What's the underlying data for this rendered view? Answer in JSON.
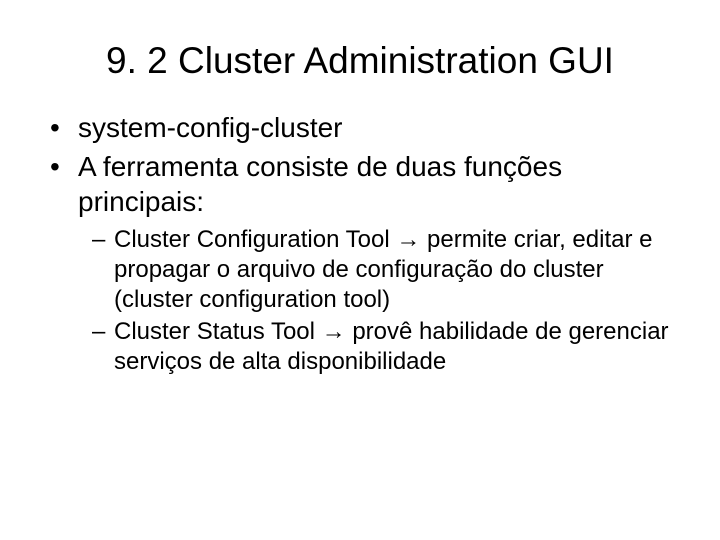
{
  "title": "9. 2 Cluster Administration GUI",
  "bullets": {
    "b1": "system-config-cluster",
    "b2": "A ferramenta consiste de duas funções principais:",
    "sub1": "Cluster Configuration Tool → permite criar, editar e propagar o arquivo de configuração do cluster (cluster configuration tool)",
    "sub2": "Cluster Status Tool → provê habilidade de gerenciar serviços de alta disponibilidade"
  }
}
